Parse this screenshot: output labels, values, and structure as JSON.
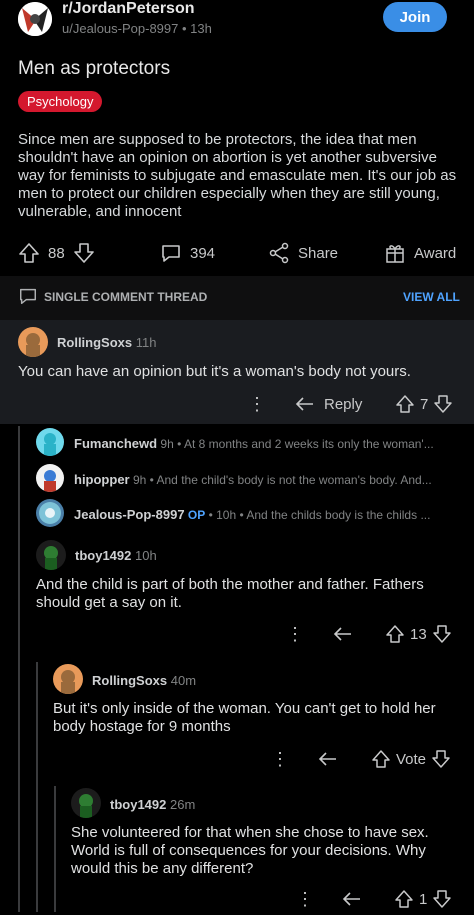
{
  "header": {
    "subreddit": "r/JordanPeterson",
    "meta": "u/Jealous-Pop-8997 • 13h",
    "join_label": "Join"
  },
  "post": {
    "title": "Men as protectors",
    "flair": "Psychology",
    "body": "Since men are supposed to be protectors, the idea that men shouldn't have an opinion on abortion is yet another subversive way for feminists to subjugate and emasculate men. It's our job as men to protect our children especially when they are still young, vulnerable, and innocent",
    "votes": "88",
    "comments": "394",
    "share_label": "Share",
    "award_label": "Award"
  },
  "thread": {
    "label": "SINGLE COMMENT THREAD",
    "view_all": "VIEW ALL"
  },
  "comments": {
    "c1": {
      "user": "RollingSoxs",
      "time": "11h",
      "text": "You can have an opinion but it's a woman's body not yours.",
      "reply": "Reply",
      "votes": "7"
    },
    "c2": {
      "user": "Fumanchewd",
      "preview": "9h • At 8 months and 2 weeks its only the woman'..."
    },
    "c3": {
      "user": "hipopper",
      "preview": "9h • And the child's body is not the woman's body. And..."
    },
    "c4": {
      "user": "Jealous-Pop-8997",
      "op": "OP",
      "preview": "• 10h • And the childs body is the childs ..."
    },
    "c5": {
      "user": "tboy1492",
      "time": "10h",
      "text": "And the child is part of both the mother and father. Fathers should get a say on it.",
      "votes": "13"
    },
    "c6": {
      "user": "RollingSoxs",
      "time": "40m",
      "text": "But it's only inside of the woman. You can't get to hold her body hostage for 9 months",
      "votes": "Vote"
    },
    "c7": {
      "user": "tboy1492",
      "time": "26m",
      "text": "She volunteered for that when she chose to have sex. World is full of consequences for your decisions. Why would this be any different?",
      "votes": "1"
    }
  },
  "icons": [
    "upvote-icon",
    "downvote-icon",
    "comment-icon",
    "share-icon",
    "award-icon",
    "reply-icon",
    "more-icon"
  ],
  "colors": {
    "join": "#3a8ee6",
    "flair": "#d4182e",
    "link": "#4fa3ff"
  }
}
